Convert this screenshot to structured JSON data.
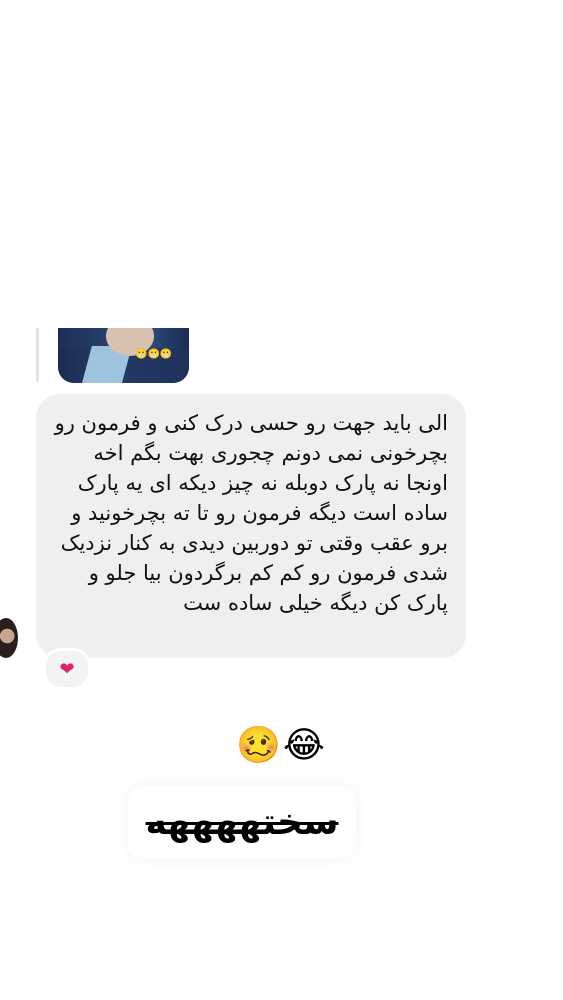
{
  "reply_preview": {
    "emoji": "😬😬😬"
  },
  "message": {
    "text": "الی باید جهت رو حسی درک کنی و فرمون رو بچرخونی نمی دونم چجوری بهت بگم اخه اونجا نه پارک دوبله نه چیز دیکه ای یه پارک ساده است دیگه فرمون رو تا ته بچرخونید و برو عقب وقتی تو دوربین دیدی به کنار نزدیک شدی فرمون رو کم کم برگردون بیا جلو و پارک کن دیگه خیلی ساده ست",
    "reaction": "❤",
    "reaction_color": "#e0245e"
  },
  "story_overlay": {
    "emojis": "🥴😂",
    "sticker_text": "سختههههه"
  }
}
